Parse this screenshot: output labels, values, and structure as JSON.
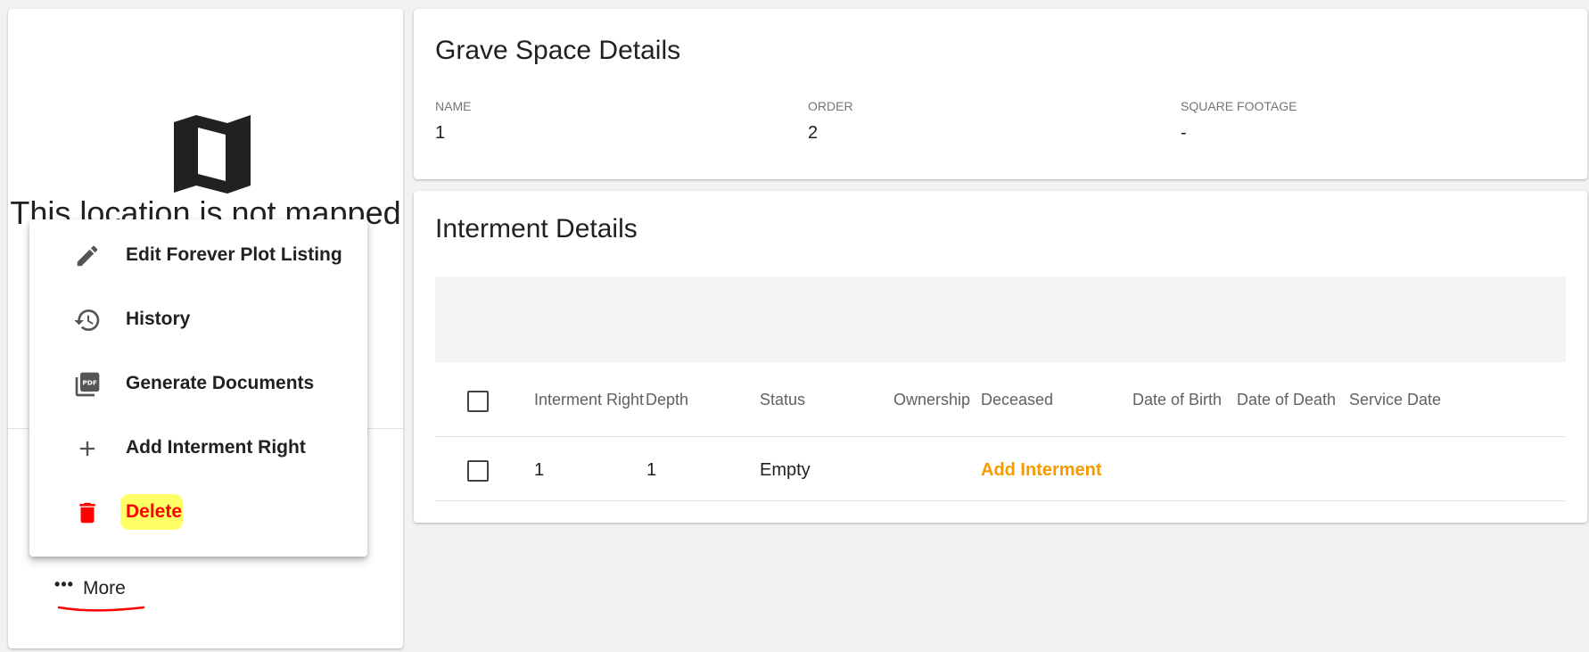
{
  "left_panel": {
    "map_icon": "map-icon",
    "unmapped_message": "This location is not mapped"
  },
  "more_menu": {
    "items": [
      {
        "label": "Edit Forever Plot Listing",
        "icon": "pencil-icon"
      },
      {
        "label": "History",
        "icon": "history-icon"
      },
      {
        "label": "Generate Documents",
        "icon": "pdf-icon"
      },
      {
        "label": "Add Interment Right",
        "icon": "plus-icon"
      },
      {
        "label": "Delete",
        "icon": "trash-icon"
      }
    ],
    "delete_color": "#ff0000",
    "delete_highlight_color": "#ffff66"
  },
  "more_button": {
    "dots": "•••",
    "label": "More",
    "annotation_color": "#ff0000"
  },
  "grave_space": {
    "title": "Grave Space Details",
    "fields": [
      {
        "label": "Name",
        "value": "1"
      },
      {
        "label": "Order",
        "value": "2"
      },
      {
        "label": "Square Footage",
        "value": "-"
      }
    ]
  },
  "interment": {
    "title": "Interment Details",
    "columns": [
      "Interment Right",
      "Depth",
      "Status",
      "Ownership",
      "Deceased",
      "Date of Birth",
      "Date of Death",
      "Service Date"
    ],
    "rows": [
      {
        "interment_right": "1",
        "depth": "1",
        "status": "Empty",
        "ownership": "",
        "deceased_action": "Add Interment",
        "date_of_birth": "",
        "date_of_death": "",
        "service_date": ""
      }
    ],
    "link_color": "#f59b00"
  }
}
